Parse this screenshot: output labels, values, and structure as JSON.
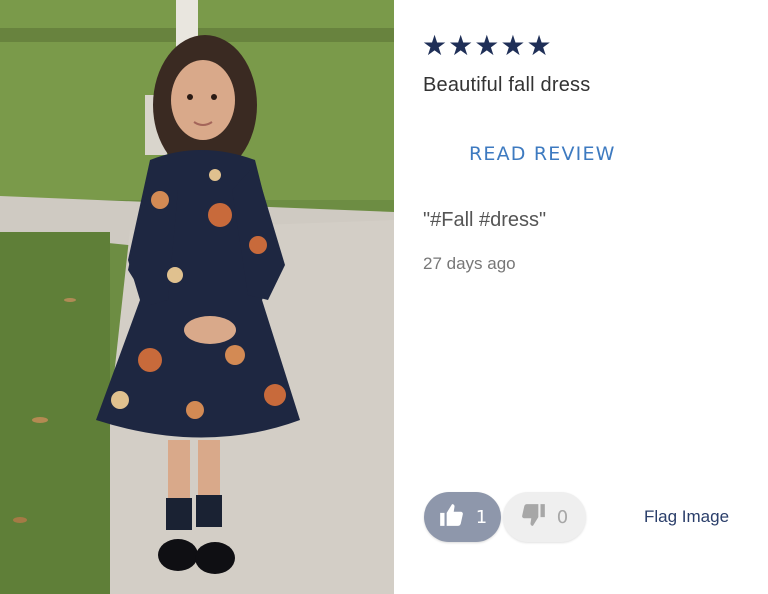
{
  "review": {
    "rating": 5,
    "stars": [
      "★",
      "★",
      "★",
      "★",
      "★"
    ],
    "title": "Beautiful fall dress",
    "read_review_label": "READ REVIEW",
    "quote": "\"#Fall #dress\"",
    "age": "27 days ago"
  },
  "votes": {
    "helpful_count": "1",
    "unhelpful_count": "0",
    "helpful_icon": "thumbs-up-icon",
    "unhelpful_icon": "thumbs-down-icon"
  },
  "flag_label": "Flag Image",
  "colors": {
    "star": "#1f2f57",
    "link": "#3d7ac0",
    "vote_active": "#8e97ab",
    "vote_inactive": "#efefef",
    "flag": "#2a3e6a"
  }
}
